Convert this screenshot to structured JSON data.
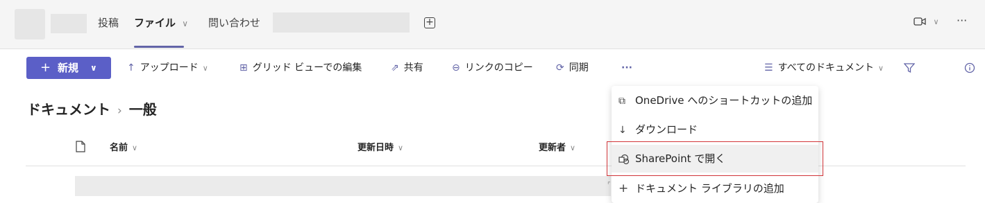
{
  "header": {
    "tabs": [
      {
        "label": "投稿",
        "active": false
      },
      {
        "label": "ファイル",
        "active": true
      },
      {
        "label": "問い合わせ",
        "active": false
      }
    ],
    "dropdown_glyph": "⌵",
    "add_tab_icon": "plus-square-icon",
    "meet_icon": "video-camera-icon",
    "more_label": "···"
  },
  "toolbar": {
    "new_label": "新規",
    "upload_label": "アップロード",
    "grid_edit_label": "グリッド ビューでの編集",
    "share_label": "共有",
    "copy_link_label": "リンクのコピー",
    "sync_label": "同期",
    "more_label": "···",
    "view_label": "すべてのドキュメント"
  },
  "breadcrumb": {
    "root": "ドキュメント",
    "separator": "›",
    "current": "一般"
  },
  "columns": {
    "name": "名前",
    "modified": "更新日時",
    "modified_by": "更新者"
  },
  "menu": {
    "items": [
      {
        "label": "OneDrive へのショートカットの追加",
        "icon": "shortcut-icon"
      },
      {
        "label": "ダウンロード",
        "icon": "download-icon"
      },
      {
        "label": "SharePoint で開く",
        "icon": "sharepoint-icon",
        "highlighted": true
      },
      {
        "label": "ドキュメント ライブラリの追加",
        "icon": "plus-icon"
      }
    ]
  },
  "colors": {
    "accent": "#5b5fc7",
    "highlight_border": "#d13438"
  }
}
